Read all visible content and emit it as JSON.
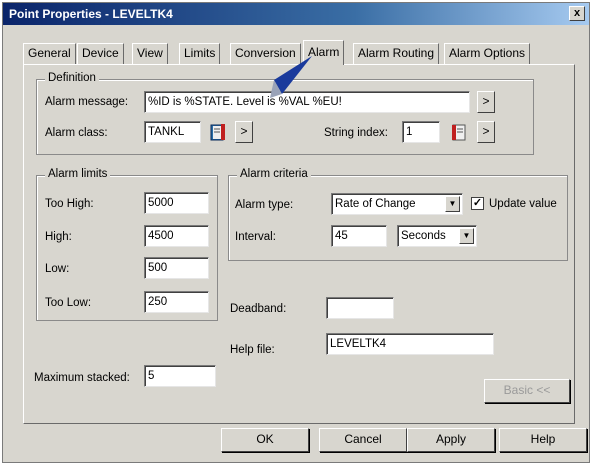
{
  "window": {
    "title": "Point Properties - LEVELTK4",
    "close": "x"
  },
  "tabs": [
    {
      "label": "General"
    },
    {
      "label": "Device"
    },
    {
      "label": "View"
    },
    {
      "label": "Limits"
    },
    {
      "label": "Conversion"
    },
    {
      "label": "Alarm"
    },
    {
      "label": "Alarm Routing"
    },
    {
      "label": "Alarm Options"
    }
  ],
  "definition": {
    "legend": "Definition",
    "alarm_message_label": "Alarm message:",
    "alarm_message_value": "%ID is %STATE. Level is %VAL %EU!",
    "alarm_class_label": "Alarm class:",
    "alarm_class_value": "TANKL",
    "string_index_label": "String index:",
    "string_index_value": "1",
    "browse_label": ">"
  },
  "limits": {
    "legend": "Alarm limits",
    "too_high_label": "Too High:",
    "too_high_value": "5000",
    "high_label": "High:",
    "high_value": "4500",
    "low_label": "Low:",
    "low_value": "500",
    "too_low_label": "Too Low:",
    "too_low_value": "250"
  },
  "criteria": {
    "legend": "Alarm criteria",
    "alarm_type_label": "Alarm type:",
    "alarm_type_value": "Rate of Change",
    "update_value_label": "Update value",
    "update_value_checked": true,
    "interval_label": "Interval:",
    "interval_value": "45",
    "interval_unit": "Seconds"
  },
  "deadband": {
    "label": "Deadband:",
    "value": ""
  },
  "help_file": {
    "label": "Help file:",
    "value": "LEVELTK4"
  },
  "max_stacked": {
    "label": "Maximum stacked:",
    "value": "5"
  },
  "basic_button": "Basic <<",
  "buttons": {
    "ok": "OK",
    "cancel": "Cancel",
    "apply": "Apply",
    "help": "Help"
  },
  "colors": {
    "title_bar": "#0a246a",
    "dialog_bg": "#d8d6cf",
    "pointer": "#1a3a9c"
  }
}
